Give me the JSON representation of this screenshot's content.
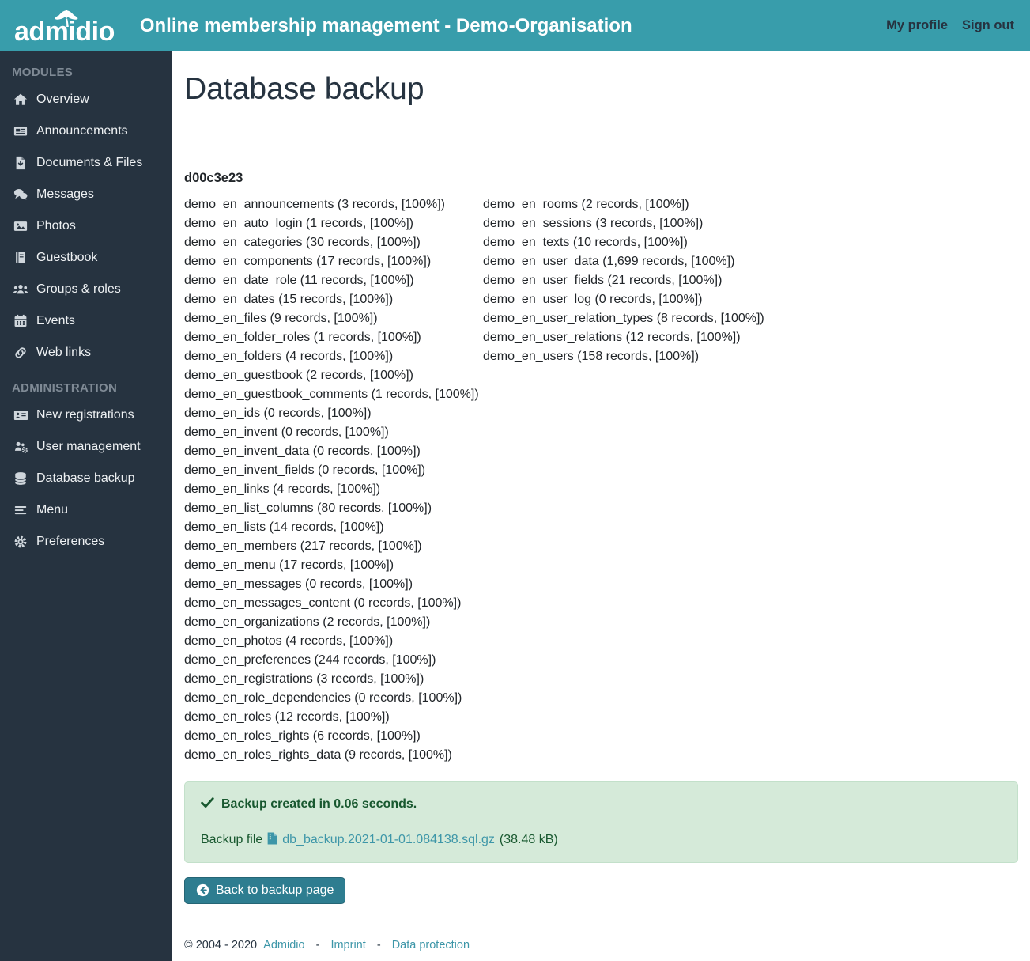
{
  "colors": {
    "header_teal": "#389dab",
    "sidebar_navy": "#263340",
    "link_teal": "#3d96a8",
    "success_bg": "#d5ead9",
    "success_text": "#18582f",
    "button_teal": "#2e7d90"
  },
  "header": {
    "logo_text": "admidio",
    "title": "Online membership management - Demo-Organisation",
    "links": [
      {
        "label": "My profile"
      },
      {
        "label": "Sign out"
      }
    ]
  },
  "sidebar": {
    "sections": [
      {
        "heading": "MODULES",
        "items": [
          {
            "label": "Overview",
            "icon": "home-icon"
          },
          {
            "label": "Announcements",
            "icon": "newspaper-icon"
          },
          {
            "label": "Documents & Files",
            "icon": "file-download-icon"
          },
          {
            "label": "Messages",
            "icon": "comments-icon"
          },
          {
            "label": "Photos",
            "icon": "image-icon"
          },
          {
            "label": "Guestbook",
            "icon": "book-icon"
          },
          {
            "label": "Groups & roles",
            "icon": "users-icon"
          },
          {
            "label": "Events",
            "icon": "calendar-icon"
          },
          {
            "label": "Web links",
            "icon": "link-icon"
          }
        ]
      },
      {
        "heading": "ADMINISTRATION",
        "items": [
          {
            "label": "New registrations",
            "icon": "address-card-icon"
          },
          {
            "label": "User management",
            "icon": "users-cog-icon"
          },
          {
            "label": "Database backup",
            "icon": "database-icon"
          },
          {
            "label": "Menu",
            "icon": "menu-bars-icon"
          },
          {
            "label": "Preferences",
            "icon": "gear-icon"
          }
        ]
      }
    ]
  },
  "main": {
    "page_title": "Database backup",
    "backup_id": "d00c3e23",
    "item_format": "{name} ({records} records, [100%])",
    "tables_left": [
      {
        "name": "demo_en_announcements",
        "records": "3"
      },
      {
        "name": "demo_en_auto_login",
        "records": "1"
      },
      {
        "name": "demo_en_categories",
        "records": "30"
      },
      {
        "name": "demo_en_components",
        "records": "17"
      },
      {
        "name": "demo_en_date_role",
        "records": "11"
      },
      {
        "name": "demo_en_dates",
        "records": "15"
      },
      {
        "name": "demo_en_files",
        "records": "9"
      },
      {
        "name": "demo_en_folder_roles",
        "records": "1"
      },
      {
        "name": "demo_en_folders",
        "records": "4"
      },
      {
        "name": "demo_en_guestbook",
        "records": "2"
      },
      {
        "name": "demo_en_guestbook_comments",
        "records": "1"
      },
      {
        "name": "demo_en_ids",
        "records": "0"
      },
      {
        "name": "demo_en_invent",
        "records": "0"
      },
      {
        "name": "demo_en_invent_data",
        "records": "0"
      },
      {
        "name": "demo_en_invent_fields",
        "records": "0"
      },
      {
        "name": "demo_en_links",
        "records": "4"
      },
      {
        "name": "demo_en_list_columns",
        "records": "80"
      },
      {
        "name": "demo_en_lists",
        "records": "14"
      },
      {
        "name": "demo_en_members",
        "records": "217"
      },
      {
        "name": "demo_en_menu",
        "records": "17"
      },
      {
        "name": "demo_en_messages",
        "records": "0"
      },
      {
        "name": "demo_en_messages_content",
        "records": "0"
      },
      {
        "name": "demo_en_organizations",
        "records": "2"
      },
      {
        "name": "demo_en_photos",
        "records": "4"
      },
      {
        "name": "demo_en_preferences",
        "records": "244"
      },
      {
        "name": "demo_en_registrations",
        "records": "3"
      },
      {
        "name": "demo_en_role_dependencies",
        "records": "0"
      },
      {
        "name": "demo_en_roles",
        "records": "12"
      },
      {
        "name": "demo_en_roles_rights",
        "records": "6"
      },
      {
        "name": "demo_en_roles_rights_data",
        "records": "9"
      }
    ],
    "tables_right": [
      {
        "name": "demo_en_rooms",
        "records": "2"
      },
      {
        "name": "demo_en_sessions",
        "records": "3"
      },
      {
        "name": "demo_en_texts",
        "records": "10"
      },
      {
        "name": "demo_en_user_data",
        "records": "1,699"
      },
      {
        "name": "demo_en_user_fields",
        "records": "21"
      },
      {
        "name": "demo_en_user_log",
        "records": "0"
      },
      {
        "name": "demo_en_user_relation_types",
        "records": "8"
      },
      {
        "name": "demo_en_user_relations",
        "records": "12"
      },
      {
        "name": "demo_en_users",
        "records": "158"
      }
    ],
    "alert": {
      "message": "Backup created in 0.06 seconds.",
      "file_label": "Backup file",
      "file_name": "db_backup.2021-01-01.084138.sql.gz",
      "file_size": "(38.48 kB)"
    },
    "back_button_label": "Back to backup page",
    "footer": {
      "copyright": "© 2004 - 2020",
      "links": [
        "Admidio",
        "Imprint",
        "Data protection"
      ],
      "separator": "-"
    }
  }
}
